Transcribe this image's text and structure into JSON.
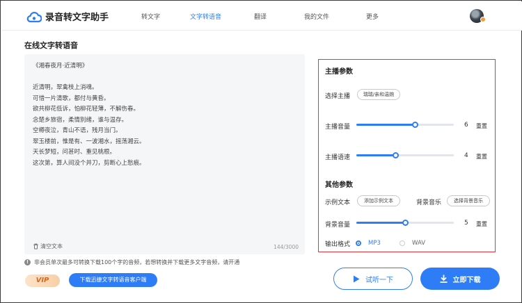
{
  "app": {
    "name": "录音转文字助手"
  },
  "nav": {
    "items": [
      {
        "label": "转文字"
      },
      {
        "label": "文字转语音"
      },
      {
        "label": "翻译"
      },
      {
        "label": "我的文件"
      },
      {
        "label": "更多"
      }
    ],
    "active_index": 1
  },
  "page": {
    "title": "在线文字转语音"
  },
  "editor": {
    "lines": [
      "《湘春夜月·近清明》",
      "",
      "近清明，翠禽枝上消魂。",
      "可惜一片清歌，都付与黄昏。",
      "欲共柳花低诉，怕柳花轻薄，不解伤春。",
      "念楚乡旅宿，柔情别绪，谁与温存。",
      "空樽夜泣，青山不语，残月当门。",
      "翠玉楼前，惟是有、一波湘水，摇荡湘云。",
      "天长梦短，问甚时、重见桃根。",
      "这次第，算人间没个并刀，剪断心上愁痕。"
    ],
    "clear_label": "清空文本",
    "counter": "144/3000"
  },
  "notice": {
    "text": "非会员单次最多可转换下载100个字的音频，若想转换并下载更多文字音频，请开通"
  },
  "vip": {
    "label": "VIP"
  },
  "client_download": {
    "label": "下载迅捷文字转语音客户端"
  },
  "settings": {
    "anchor_section": "主播参数",
    "anchor_label": "选择主播",
    "anchor_value": "瑞瑞/亲和温婉",
    "volume": {
      "label": "主播音量",
      "value": 6,
      "max": 10,
      "reset": "重置"
    },
    "speed": {
      "label": "主播语速",
      "value": 4,
      "max": 10,
      "reset": "重置"
    },
    "other_section": "其他参数",
    "sample_label": "示例文本",
    "sample_button": "添加示例文本",
    "bgm_label": "背景音乐",
    "bgm_button": "选择背景音乐",
    "bg_volume": {
      "label": "背景音量",
      "value": 5,
      "max": 10,
      "reset": "重置"
    },
    "format_label": "输出格式",
    "formats": [
      "MP3",
      "WAV"
    ],
    "selected_format": "MP3"
  },
  "actions": {
    "listen": "试听一下",
    "download": "立即下载"
  },
  "colors": {
    "accent": "#2f7df6",
    "highlight_border": "#e4353f",
    "vip_text": "#d36b22"
  }
}
